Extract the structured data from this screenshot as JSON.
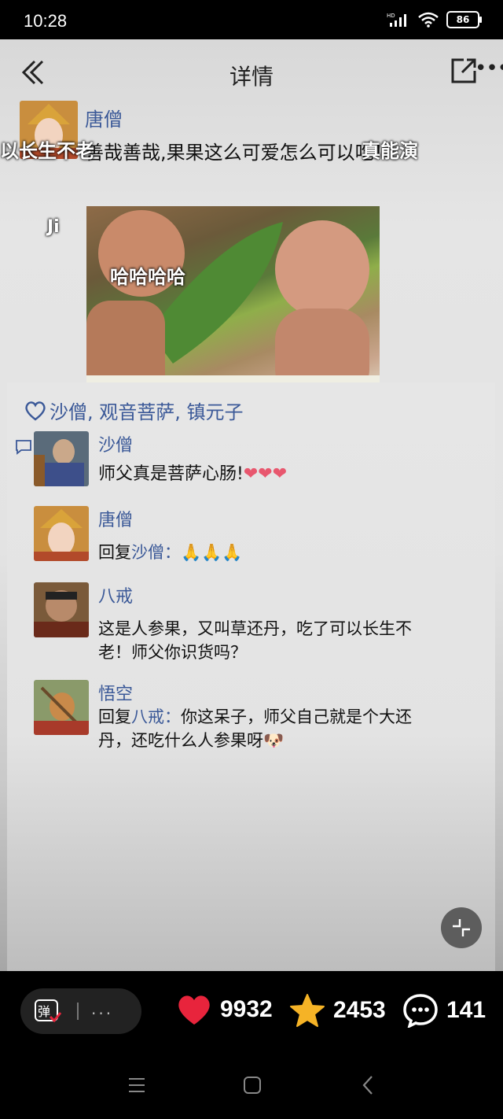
{
  "status_bar": {
    "time": "10:28",
    "network": "HD",
    "battery": "86"
  },
  "header": {
    "title": "详情"
  },
  "post": {
    "author": "唐僧",
    "text": "善哉善哉,果果这么可爱怎么可以吃！",
    "danmaku": [
      "以长生不老",
      "真能演",
      "Ji",
      "哈哈哈哈"
    ]
  },
  "likes": {
    "names": "沙僧, 观音菩萨, 镇元子"
  },
  "comments": [
    {
      "name": "沙僧",
      "text": "师父真是菩萨心肠!",
      "emoji": "❤❤❤"
    },
    {
      "name": "唐僧",
      "reply_prefix": "回复",
      "reply_to": "沙僧",
      "sep": "：",
      "text": "",
      "emoji": "🙏🙏🙏"
    },
    {
      "name": "八戒",
      "text": "这是人参果，又叫草还丹，吃了可以长生不老！师父你识货吗？"
    },
    {
      "name": "悟空",
      "reply_prefix": "回复",
      "reply_to": "八戒",
      "sep": "：",
      "text": "你这呆子，师父自己就是个大还丹，还吃什么人参果呀",
      "emoji": "🐶"
    }
  ],
  "action_bar": {
    "danmaku_label": "弹",
    "dots": "...",
    "likes": "9932",
    "favorites": "2453",
    "comments": "141"
  },
  "colors": {
    "link": "#3b5998",
    "heart": "#e8243c",
    "star": "#f5b326"
  }
}
